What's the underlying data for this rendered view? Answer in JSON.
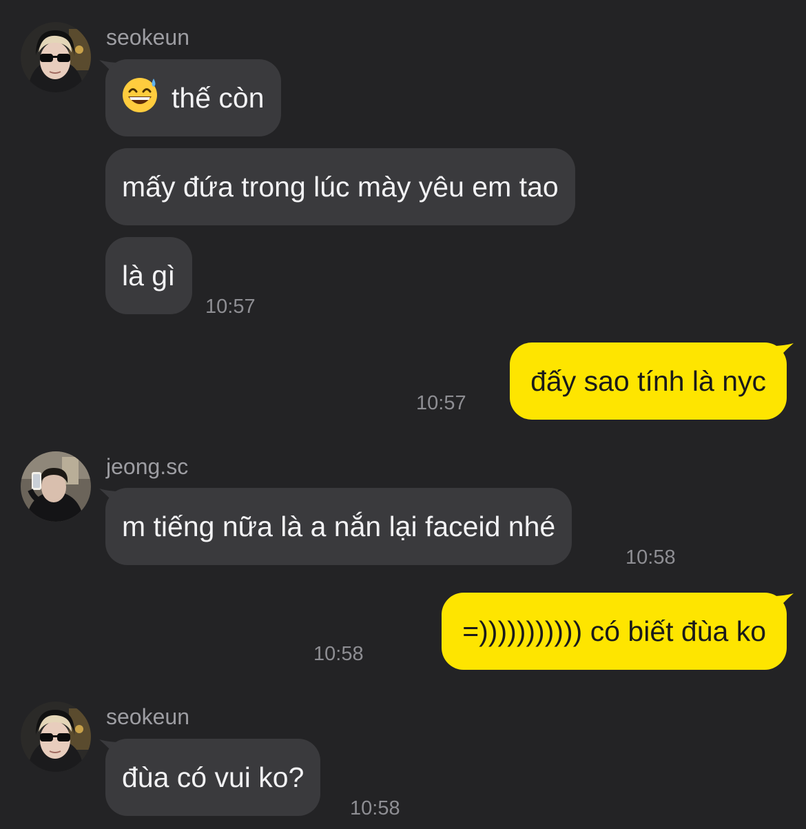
{
  "messages": [
    {
      "sender": "seokeun",
      "avatar_icon": "user-avatar-sunglasses-icon",
      "bubbles": [
        {
          "emoji": "grinning-face-with-sweat-icon",
          "text": "thế còn"
        },
        {
          "text": "mấy đứa trong lúc mày yêu em tao"
        },
        {
          "text": "là gì"
        }
      ],
      "time": "10:57"
    },
    {
      "outgoing": true,
      "text": "đấy sao tính là nyc",
      "time": "10:57"
    },
    {
      "sender": "jeong.sc",
      "avatar_icon": "user-avatar-selfie-icon",
      "bubbles": [
        {
          "text": "m tiếng nữa là a nắn lại faceid nhé"
        }
      ],
      "time": "10:58"
    },
    {
      "outgoing": true,
      "text": "=))))))))))) có biết đùa ko",
      "time": "10:58"
    },
    {
      "sender": "seokeun",
      "avatar_icon": "user-avatar-sunglasses-icon",
      "bubbles": [
        {
          "text": "đùa có vui ko?"
        }
      ],
      "time": "10:58"
    }
  ],
  "colors": {
    "background": "#232325",
    "incoming_bubble": "#3a3a3d",
    "outgoing_bubble": "#fee500",
    "timestamp": "#8e8e93",
    "sender_name": "#9d9da2"
  }
}
